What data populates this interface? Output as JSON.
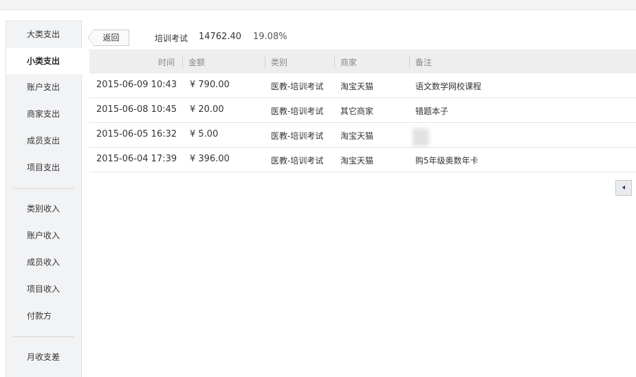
{
  "sidebar": {
    "expense_items": [
      {
        "label": "大类支出"
      },
      {
        "label": "小类支出"
      },
      {
        "label": "账户支出"
      },
      {
        "label": "商家支出"
      },
      {
        "label": "成员支出"
      },
      {
        "label": "项目支出"
      }
    ],
    "income_items": [
      {
        "label": "类别收入"
      },
      {
        "label": "账户收入"
      },
      {
        "label": "成员收入"
      },
      {
        "label": "项目收入"
      },
      {
        "label": "付款方"
      }
    ],
    "other_items": [
      {
        "label": "月收支差"
      }
    ],
    "active": "小类支出"
  },
  "summary": {
    "back_label": "返回",
    "category": "培训考试",
    "amount": "14762.40",
    "percent": "19.08%"
  },
  "table": {
    "headers": {
      "time": "时间",
      "amount": "金额",
      "category": "类别",
      "merchant": "商家",
      "note": "备注"
    },
    "rows": [
      {
        "time": "2015-06-09 10:43",
        "amount": "¥ 790.00",
        "category": "医教-培训考试",
        "merchant": "淘宝天猫",
        "note": "语文数学网校课程"
      },
      {
        "time": "2015-06-08 10:45",
        "amount": "¥ 20.00",
        "category": "医教-培训考试",
        "merchant": "其它商家",
        "note": "错题本子"
      },
      {
        "time": "2015-06-05 16:32",
        "amount": "¥ 5.00",
        "category": "医教-培训考试",
        "merchant": "淘宝天猫",
        "note": ""
      },
      {
        "time": "2015-06-04 17:39",
        "amount": "¥ 396.00",
        "category": "医教-培训考试",
        "merchant": "淘宝天猫",
        "note": "购5年级奥数年卡"
      }
    ]
  },
  "icons": {
    "collapse": "caret-left-icon"
  }
}
